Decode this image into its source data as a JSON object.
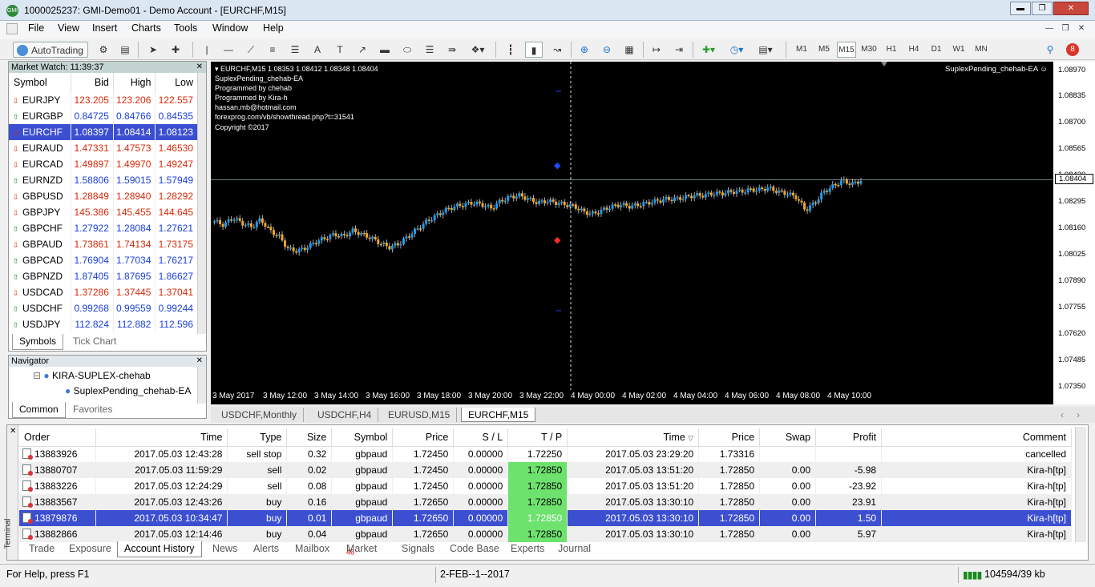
{
  "window": {
    "title": "1000025237: GMI-Demo01 - Demo Account - [EURCHF,M15]",
    "app_icon": "GMI"
  },
  "menu": [
    "File",
    "View",
    "Insert",
    "Charts",
    "Tools",
    "Window",
    "Help"
  ],
  "toolbar": {
    "autotrading": "AutoTrading",
    "timeframes": [
      "M1",
      "M5",
      "M15",
      "M30",
      "H1",
      "H4",
      "D1",
      "W1",
      "MN"
    ],
    "active_tf": "M15",
    "notification_count": "8"
  },
  "market_watch": {
    "title": "Market Watch: 11:39:37",
    "headers": [
      "Symbol",
      "Bid",
      "High",
      "Low"
    ],
    "rows": [
      {
        "symbol": "EURJPY",
        "bid": "123.205",
        "high": "123.206",
        "low": "122.557",
        "dir": "down"
      },
      {
        "symbol": "EURGBP",
        "bid": "0.84725",
        "high": "0.84766",
        "low": "0.84535",
        "dir": "up"
      },
      {
        "symbol": "EURCHF",
        "bid": "1.08397",
        "high": "1.08414",
        "low": "1.08123",
        "dir": "down"
      },
      {
        "symbol": "EURAUD",
        "bid": "1.47331",
        "high": "1.47573",
        "low": "1.46530",
        "dir": "down"
      },
      {
        "symbol": "EURCAD",
        "bid": "1.49897",
        "high": "1.49970",
        "low": "1.49247",
        "dir": "down"
      },
      {
        "symbol": "EURNZD",
        "bid": "1.58806",
        "high": "1.59015",
        "low": "1.57949",
        "dir": "up"
      },
      {
        "symbol": "GBPUSD",
        "bid": "1.28849",
        "high": "1.28940",
        "low": "1.28292",
        "dir": "down"
      },
      {
        "symbol": "GBPJPY",
        "bid": "145.386",
        "high": "145.455",
        "low": "144.645",
        "dir": "down"
      },
      {
        "symbol": "GBPCHF",
        "bid": "1.27922",
        "high": "1.28084",
        "low": "1.27621",
        "dir": "up"
      },
      {
        "symbol": "GBPAUD",
        "bid": "1.73861",
        "high": "1.74134",
        "low": "1.73175",
        "dir": "down"
      },
      {
        "symbol": "GBPCAD",
        "bid": "1.76904",
        "high": "1.77034",
        "low": "1.76217",
        "dir": "up"
      },
      {
        "symbol": "GBPNZD",
        "bid": "1.87405",
        "high": "1.87695",
        "low": "1.86627",
        "dir": "up"
      },
      {
        "symbol": "USDCAD",
        "bid": "1.37286",
        "high": "1.37445",
        "low": "1.37041",
        "dir": "down"
      },
      {
        "symbol": "USDCHF",
        "bid": "0.99268",
        "high": "0.99559",
        "low": "0.99244",
        "dir": "up"
      },
      {
        "symbol": "USDJPY",
        "bid": "112.824",
        "high": "112.882",
        "low": "112.596",
        "dir": "up"
      }
    ],
    "tabs": [
      "Symbols",
      "Tick Chart"
    ]
  },
  "navigator": {
    "title": "Navigator",
    "items": [
      "KIRA-SUPLEX-chehab",
      "SuplexPending_chehab-EA"
    ],
    "tabs": [
      "Common",
      "Favorites"
    ]
  },
  "chart": {
    "header": "EURCHF,M15  1.08353 1.08412 1.08348 1.08404",
    "info": [
      "SuplexPending_chehab-EA",
      "Programmed by chehab",
      "Programmed by Kira-h",
      "hassan.mb@hotmail.com",
      "forexprog.com/vb/showthread.php?t=31541",
      "Copyright ©2017"
    ],
    "ea_label": "SuplexPending_chehab-EA ☺",
    "price_tag": "1.08404",
    "y_labels": [
      "1.08970",
      "1.08835",
      "1.08700",
      "1.08565",
      "1.08430",
      "1.08295",
      "1.08160",
      "1.08025",
      "1.07890",
      "1.07755",
      "1.07620",
      "1.07485",
      "1.07350"
    ],
    "x_labels": [
      "3 May 2017",
      "3 May 12:00",
      "3 May 14:00",
      "3 May 16:00",
      "3 May 18:00",
      "3 May 20:00",
      "3 May 22:00",
      "4 May 00:00",
      "4 May 02:00",
      "4 May 04:00",
      "4 May 06:00",
      "4 May 08:00",
      "4 May 10:00"
    ],
    "bull_color": "#1e9bf0",
    "bear_color": "#f5a623",
    "tabs": [
      "USDCHF,Monthly",
      "USDCHF,H4",
      "EURUSD,M15",
      "EURCHF,M15"
    ]
  },
  "chart_data": {
    "type": "candlestick",
    "symbol": "EURCHF",
    "timeframe": "M15",
    "ylim": [
      1.0728,
      1.0904
    ],
    "close_path": [
      1.0818,
      1.0816,
      1.082,
      1.0817,
      1.0815,
      1.0819,
      1.0813,
      1.081,
      1.0803,
      1.0802,
      1.0804,
      1.0807,
      1.0809,
      1.0811,
      1.081,
      1.0813,
      1.0811,
      1.0809,
      1.0806,
      1.0804,
      1.0806,
      1.081,
      1.0814,
      1.0818,
      1.0821,
      1.0824,
      1.0826,
      1.0827,
      1.0828,
      1.0827,
      1.0825,
      1.0829,
      1.0831,
      1.0832,
      1.083,
      1.0828,
      1.0829,
      1.0828,
      1.0827,
      1.0826,
      1.0823,
      1.0822,
      1.0824,
      1.0826,
      1.0827,
      1.0826,
      1.0827,
      1.0828,
      1.0829,
      1.083,
      1.083,
      1.0831,
      1.0832,
      1.0832,
      1.0833,
      1.0833,
      1.0834,
      1.0834,
      1.0835,
      1.0835,
      1.0836,
      1.0834,
      1.0833,
      1.0831,
      1.0824,
      1.0828,
      1.0834,
      1.0837,
      1.084,
      1.0838,
      1.084
    ]
  },
  "terminal": {
    "headers": [
      "Order",
      "Time",
      "Type",
      "Size",
      "Symbol",
      "Price",
      "S / L",
      "T / P",
      "Time",
      "Price",
      "Swap",
      "Profit",
      "Comment"
    ],
    "rows": [
      {
        "order": "13883926",
        "time": "2017.05.03 12:43:28",
        "type": "sell stop",
        "size": "0.32",
        "symbol": "gbpaud",
        "price": "1.72450",
        "sl": "0.00000",
        "tp": "1.72250",
        "ctime": "2017.05.03 23:29:20",
        "cprice": "1.73316",
        "swap": "",
        "profit": "",
        "comment": "cancelled"
      },
      {
        "order": "13880707",
        "time": "2017.05.03 11:59:29",
        "type": "sell",
        "size": "0.02",
        "symbol": "gbpaud",
        "price": "1.72450",
        "sl": "0.00000",
        "tp": "1.72850",
        "ctime": "2017.05.03 13:51:20",
        "cprice": "1.72850",
        "swap": "0.00",
        "profit": "-5.98",
        "comment": "Kira-h[tp]"
      },
      {
        "order": "13883226",
        "time": "2017.05.03 12:24:29",
        "type": "sell",
        "size": "0.08",
        "symbol": "gbpaud",
        "price": "1.72450",
        "sl": "0.00000",
        "tp": "1.72850",
        "ctime": "2017.05.03 13:51:20",
        "cprice": "1.72850",
        "swap": "0.00",
        "profit": "-23.92",
        "comment": "Kira-h[tp]"
      },
      {
        "order": "13883567",
        "time": "2017.05.03 12:43:26",
        "type": "buy",
        "size": "0.16",
        "symbol": "gbpaud",
        "price": "1.72650",
        "sl": "0.00000",
        "tp": "1.72850",
        "ctime": "2017.05.03 13:30:10",
        "cprice": "1.72850",
        "swap": "0.00",
        "profit": "23.91",
        "comment": "Kira-h[tp]"
      },
      {
        "order": "13879876",
        "time": "2017.05.03 10:34:47",
        "type": "buy",
        "size": "0.01",
        "symbol": "gbpaud",
        "price": "1.72650",
        "sl": "0.00000",
        "tp": "1.72850",
        "ctime": "2017.05.03 13:30:10",
        "cprice": "1.72850",
        "swap": "0.00",
        "profit": "1.50",
        "comment": "Kira-h[tp]"
      },
      {
        "order": "13882866",
        "time": "2017.05.03 12:14:46",
        "type": "buy",
        "size": "0.04",
        "symbol": "gbpaud",
        "price": "1.72650",
        "sl": "0.00000",
        "tp": "1.72850",
        "ctime": "2017.05.03 13:30:10",
        "cprice": "1.72850",
        "swap": "0.00",
        "profit": "5.97",
        "comment": "Kira-h[tp]"
      }
    ],
    "side_label": "Terminal",
    "tabs": [
      "Trade",
      "Exposure",
      "Account History",
      "News",
      "Alerts",
      "Mailbox",
      "Market",
      "Signals",
      "Code Base",
      "Experts",
      "Journal"
    ],
    "market_badge": "46"
  },
  "status": {
    "help": "For Help, press F1",
    "profile": "2-FEB--1--2017",
    "traffic": "104594/39 kb"
  }
}
